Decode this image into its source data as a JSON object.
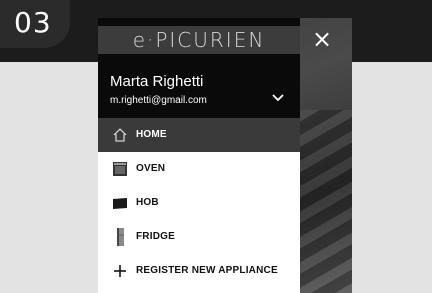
{
  "step": {
    "number": "03"
  },
  "drawer": {
    "logo": "e·PICURIEN",
    "user": {
      "name": "Marta Righetti",
      "email": "m.righetti@gmail.com"
    },
    "close_symbol": "×"
  },
  "menu": {
    "items": [
      {
        "label": "HOME",
        "icon": "home-icon",
        "active": true
      },
      {
        "label": "OVEN",
        "icon": "oven-icon",
        "active": false
      },
      {
        "label": "HOB",
        "icon": "hob-icon",
        "active": false
      },
      {
        "label": "FRIDGE",
        "icon": "fridge-icon",
        "active": false
      },
      {
        "label": "REGISTER NEW APPLIANCE",
        "icon": "plus-icon",
        "active": false
      }
    ]
  },
  "colors": {
    "header": "#0a0a0a",
    "active_item": "#3a3a3a",
    "side_panel": "#e3e3e3"
  }
}
